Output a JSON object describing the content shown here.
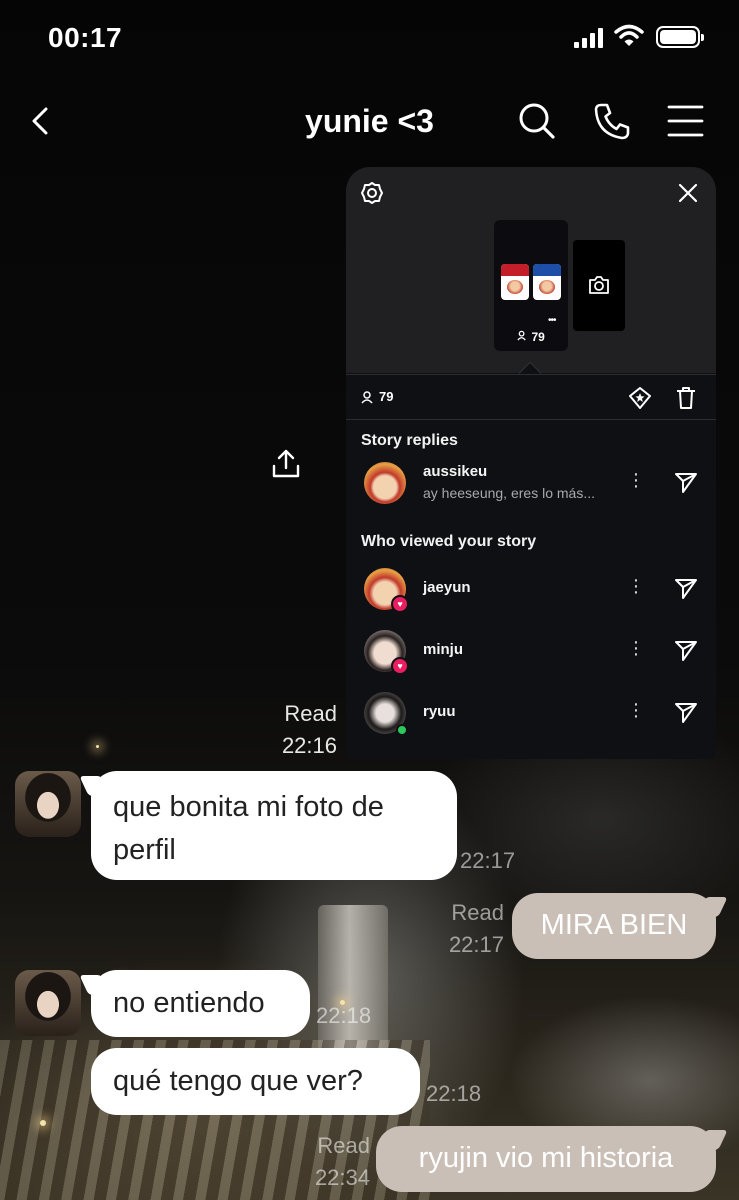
{
  "status_bar": {
    "time": "00:17"
  },
  "header": {
    "title": "yunie <3"
  },
  "story_panel": {
    "thumb_count": "79",
    "view_count": "79",
    "replies_title": "Story replies",
    "replies": [
      {
        "name": "aussikeu",
        "text": "ay heeseung, eres lo más..."
      }
    ],
    "viewers_title": "Who viewed your story",
    "viewers": [
      {
        "name": "jaeyun",
        "badge": "heart"
      },
      {
        "name": "minju",
        "badge": "heart"
      },
      {
        "name": "ryuu",
        "badge": "online"
      }
    ]
  },
  "chat": {
    "read_1": {
      "status": "Read",
      "time": "22:16"
    },
    "messages": [
      {
        "direction": "in",
        "text": "que bonita mi foto de perfil",
        "line1": "que bonita mi foto de",
        "line2": "perfil",
        "time": "22:17"
      },
      {
        "direction": "out",
        "text": "MIRA BIEN",
        "status": "Read",
        "time": "22:17"
      },
      {
        "direction": "in",
        "text": "no entiendo",
        "time": "22:18"
      },
      {
        "direction": "in",
        "text": "qué tengo que ver?",
        "time": "22:18"
      },
      {
        "direction": "out",
        "text": "ryujin vio mi historia",
        "status": "Read",
        "time": "22:34"
      }
    ]
  },
  "colors": {
    "incoming_bubble": "#ffffff",
    "outgoing_bubble": "#c9bfb6",
    "panel_bg": "#0f1014",
    "heart_badge": "#e81e60",
    "online_dot": "#2ec85a"
  }
}
